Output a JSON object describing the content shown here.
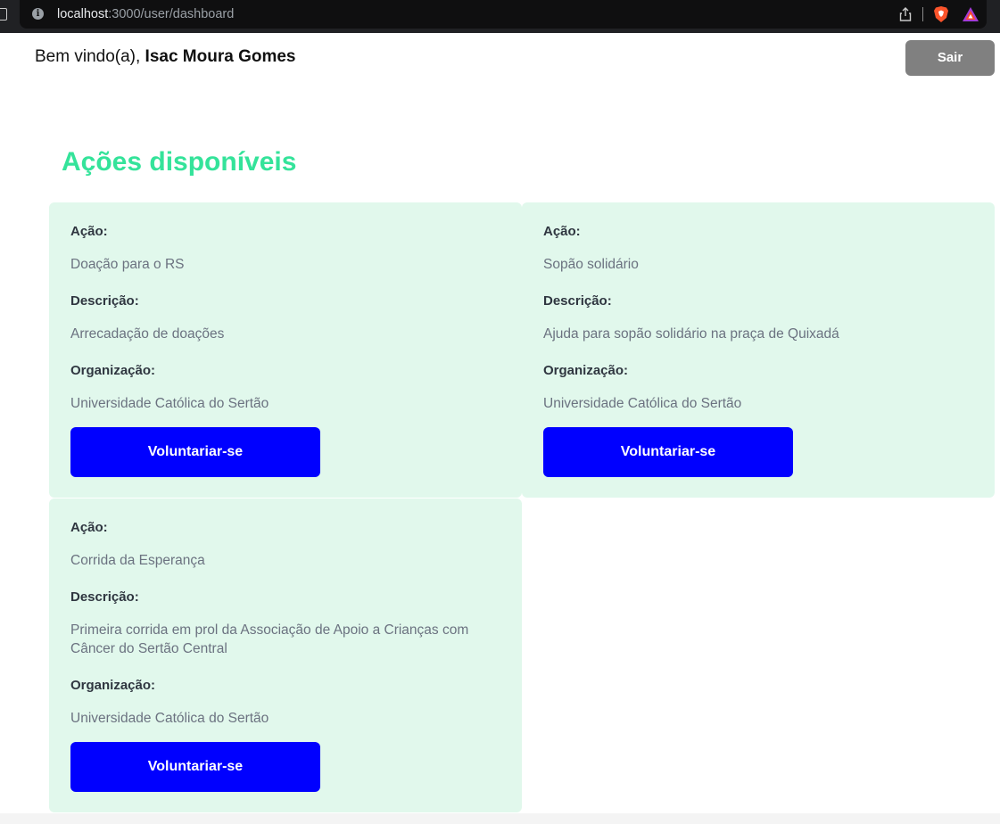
{
  "browser": {
    "url_host": "localhost",
    "url_path": ":3000/user/dashboard"
  },
  "header": {
    "welcome_prefix": "Bem vindo(a), ",
    "user_name": "Isac Moura Gomes",
    "logout_label": "Sair"
  },
  "main": {
    "title": "Ações disponíveis",
    "labels": {
      "action": "Ação:",
      "description": "Descrição:",
      "organization": "Organização:",
      "volunteer": "Voluntariar-se"
    },
    "actions": [
      {
        "name": "Doação para o RS",
        "description": "Arrecadação de doações",
        "organization": "Universidade Católica do Sertão"
      },
      {
        "name": "Sopão solidário",
        "description": "Ajuda para sopão solidário na praça de Quixadá",
        "organization": "Universidade Católica do Sertão"
      },
      {
        "name": "Corrida da Esperança",
        "description_line1": "Primeira corrida em prol da Associação de Apoio a Crianças com",
        "description_line2": "Câncer do Sertão Central",
        "organization": "Universidade Católica do Sertão"
      }
    ]
  },
  "colors": {
    "accent_title": "#34e39a",
    "card_bg": "#e1f8ec",
    "button_primary": "#0000ff",
    "button_logout": "#808080"
  }
}
